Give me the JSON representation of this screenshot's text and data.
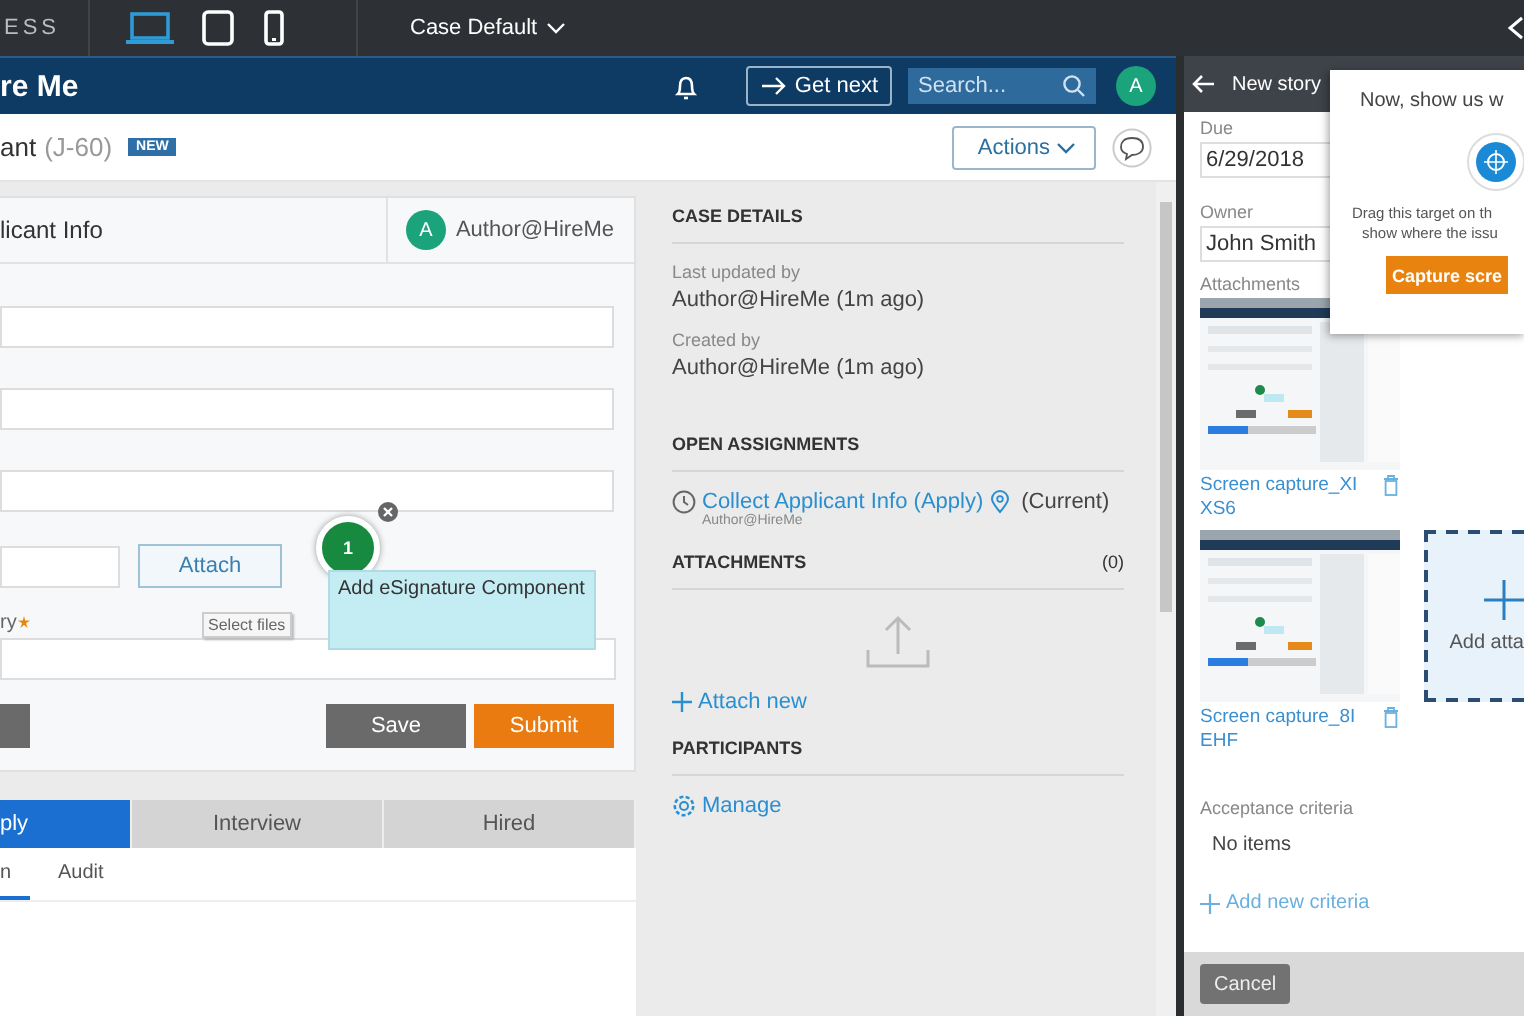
{
  "top_bar": {
    "brand": "ESS",
    "devices": [
      {
        "kind": "laptop",
        "selected": true
      },
      {
        "kind": "tablet",
        "selected": false
      },
      {
        "kind": "phone",
        "selected": false
      }
    ],
    "view_menu": "Case Default"
  },
  "app_header": {
    "title": "re Me",
    "get_next": "Get next",
    "search": {
      "placeholder": "Search..."
    },
    "avatar": "A"
  },
  "case_header": {
    "title": "ant",
    "case_id": "(J-60)",
    "badge": "NEW",
    "actions": "Actions"
  },
  "form": {
    "title": "licant Info",
    "assignee": {
      "avatar": "A",
      "name": "Author@HireMe"
    },
    "fields": [
      {
        "kind": "input"
      },
      {
        "kind": "input"
      },
      {
        "kind": "input"
      },
      {
        "kind": "file",
        "button": "Attach"
      },
      {
        "kind": "labeled",
        "label": "ry",
        "required": true
      }
    ],
    "buttons": [
      {
        "kind": "default"
      },
      {
        "kind": "secondary",
        "label": "Save"
      },
      {
        "kind": "primary",
        "label": "Submit"
      }
    ]
  },
  "annotation": {
    "number": "1",
    "note": "Add eSignature Component"
  },
  "tooltip": "Select files",
  "stages": [
    {
      "label": "ply",
      "selected": true
    },
    {
      "label": "Interview",
      "selected": false
    },
    {
      "label": "Hired",
      "selected": false
    }
  ],
  "tabs": [
    {
      "label": "n",
      "selected": true
    },
    {
      "label": "Audit",
      "selected": false
    }
  ],
  "case_details": {
    "heading": "CASE DETAILS",
    "items": [
      {
        "label": "Last updated by",
        "value": "Author@HireMe (1m ago)"
      },
      {
        "label": "Created by",
        "value": "Author@HireMe (1m ago)"
      }
    ]
  },
  "open_assignments": {
    "heading": "OPEN ASSIGNMENTS",
    "items": [
      {
        "link": "Collect Applicant Info (Apply)",
        "status": "(Current)",
        "assignee": "Author@HireMe"
      }
    ]
  },
  "attachments": {
    "heading": "ATTACHMENTS",
    "count": "(0)",
    "action": "Attach new"
  },
  "participants": {
    "heading": "PARTICIPANTS",
    "action": "Manage"
  },
  "story_panel": {
    "title": "New story",
    "fields": [
      {
        "label": "Due",
        "value": "6/29/2018"
      },
      {
        "label": "Owner",
        "value": "John Smith"
      }
    ],
    "attachments_label": "Attachments",
    "attachments": [
      {
        "kind": "picture",
        "name": "Screen capture_XI XS6"
      },
      {
        "kind": "picture",
        "name": "Screen capture_8I EHF"
      }
    ],
    "add_tile": "Add atta",
    "criteria_label": "Acceptance criteria",
    "criteria_empty": "No items",
    "add_criteria": "Add new criteria",
    "cancel": "Cancel"
  },
  "capture_popup": {
    "title": "Now, show us w",
    "hint_lines": [
      "Drag this target on th",
      "show where the issu"
    ],
    "button": "Capture scre"
  }
}
